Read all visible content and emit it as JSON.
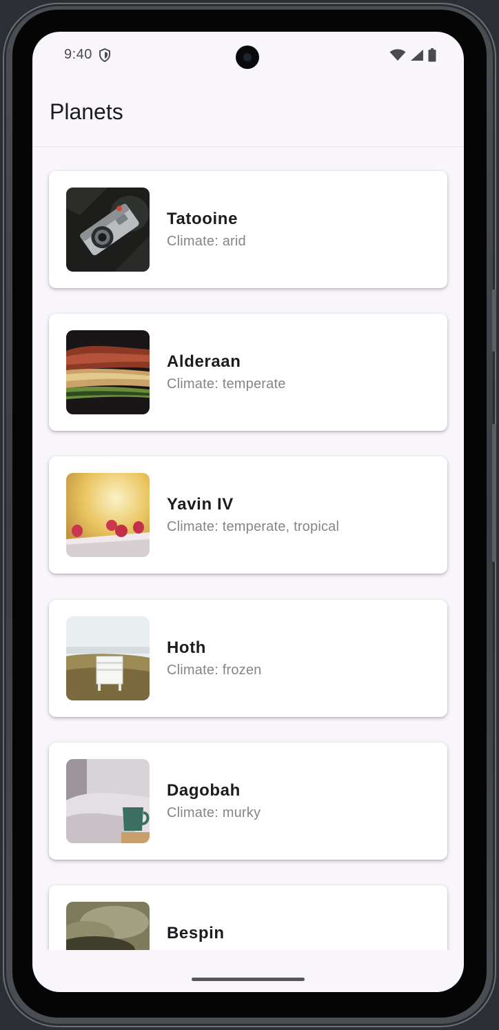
{
  "status_bar": {
    "time": "9:40",
    "icons": [
      "shield-icon",
      "wifi-icon",
      "cellular-signal-icon",
      "battery-icon"
    ]
  },
  "app_bar": {
    "title": "Planets"
  },
  "planets": [
    {
      "name": "Tatooine",
      "climate": "Climate: arid",
      "image": "camera-photo"
    },
    {
      "name": "Alderaan",
      "climate": "Climate: temperate",
      "image": "grilled-food-photo"
    },
    {
      "name": "Yavin IV",
      "climate": "Climate: temperate, tropical",
      "image": "raspberries-photo"
    },
    {
      "name": "Hoth",
      "climate": "Climate: frozen",
      "image": "beach-chair-photo"
    },
    {
      "name": "Dagobah",
      "climate": "Climate: murky",
      "image": "bed-mug-photo"
    },
    {
      "name": "Bespin",
      "climate": "",
      "image": "clouds-photo"
    }
  ],
  "colors": {
    "background": "#f8f5fb",
    "card": "#ffffff",
    "title_text": "#1c1b1f",
    "subtitle_text": "#85848a"
  }
}
